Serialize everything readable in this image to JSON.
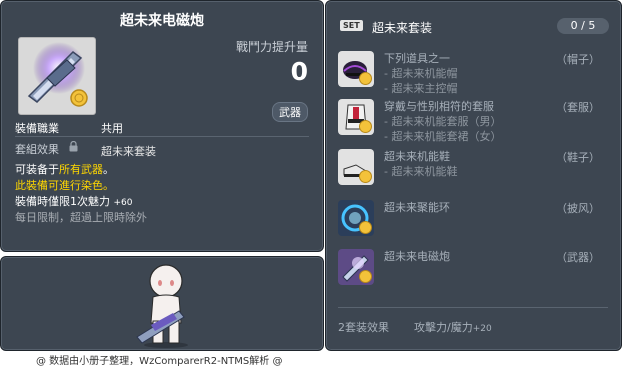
{
  "image_id_label": "01703455",
  "item": {
    "name": "超未来电磁炮",
    "cp_label": "戰鬥力提升量",
    "cp_value": "0",
    "type_badge": "武器",
    "job_key": "裝備職業",
    "job_value": "共用",
    "set_key": "套組效果",
    "set_value": "超未来套装",
    "desc": {
      "line1_prefix": "可装备于",
      "line1_highlight": "所有武器",
      "line1_suffix": "。",
      "line2": "此裝備可進行染色。",
      "line3_text": "裝備時僅限1次魅力",
      "line3_bonus": "+60",
      "line4": "每日限制，超過上限時除外"
    }
  },
  "footer": "@ 数据由小册子整理，WzComparerR2-NTMS解析 @",
  "set": {
    "badge": "SET",
    "name": "超未来套装",
    "count": "0 / 5",
    "items": [
      {
        "line": "下列道具之一",
        "slot": "（帽子）",
        "subs": [
          "- 超未来机能帽",
          "- 超未来主控帽"
        ],
        "icon": "cap-icon"
      },
      {
        "line": "穿戴与性别相符的套服",
        "slot": "（套服）",
        "subs": [
          "- 超未来机能套服（男）",
          "- 超未来机能套裙（女）"
        ],
        "icon": "suit-icon"
      },
      {
        "line": "超未来机能鞋",
        "slot": "（鞋子）",
        "subs": [
          "- 超未来机能鞋"
        ],
        "icon": "shoes-icon"
      },
      {
        "line": "超未来聚能环",
        "slot": "（披风）",
        "subs": [],
        "icon": "ring-icon"
      },
      {
        "line": "超未来电磁炮",
        "slot": "（武器）",
        "subs": [],
        "icon": "railgun-icon"
      }
    ],
    "bonus_label": "2套装效果",
    "bonus_effect": "攻擊力/魔力",
    "bonus_value": "+20"
  },
  "colors": {
    "panel_bg": "#3d4651",
    "highlight_yellow": "#ffd700",
    "muted": "#a7b0ba"
  }
}
